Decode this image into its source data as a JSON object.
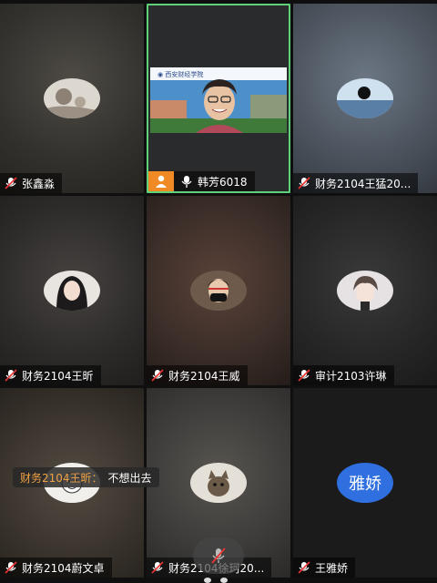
{
  "participants": [
    {
      "name": "张鑫淼",
      "bg": "#3b3a37",
      "avatar": "moon-icon"
    },
    {
      "name": "韩芳6018",
      "bg": "#2a2b2d",
      "active": true,
      "role": "host"
    },
    {
      "name": "财务2104王猛20...",
      "bg": "#4a525c",
      "avatar": "scenery-icon"
    },
    {
      "name": "财务2104王昕",
      "bg": "#2d2b2a",
      "avatar": "girl-portrait-icon"
    },
    {
      "name": "财务2104王威",
      "bg": "#3a2d28",
      "avatar": "masked-person-icon"
    },
    {
      "name": "审计2103许琳",
      "bg": "#262626",
      "avatar": "boy-portrait-icon"
    },
    {
      "name": "财务2104蔚文卓",
      "bg": "#3a342d",
      "avatar": "cartoon-icon"
    },
    {
      "name": "财务2104徐珂20...",
      "bg": "#3c3b3a",
      "avatar": "cat-icon"
    },
    {
      "name": "王雅娇",
      "bg": "#1b1b1c",
      "avatar_text": "雅娇"
    }
  ],
  "chat": {
    "sender": "财务2104王昕：",
    "message": "不想出去"
  },
  "colors": {
    "active_border": "#5fd17a",
    "host_badge": "#f08a24",
    "text_avatar": "#2f6fe0",
    "chat_sender": "#f0a044"
  }
}
